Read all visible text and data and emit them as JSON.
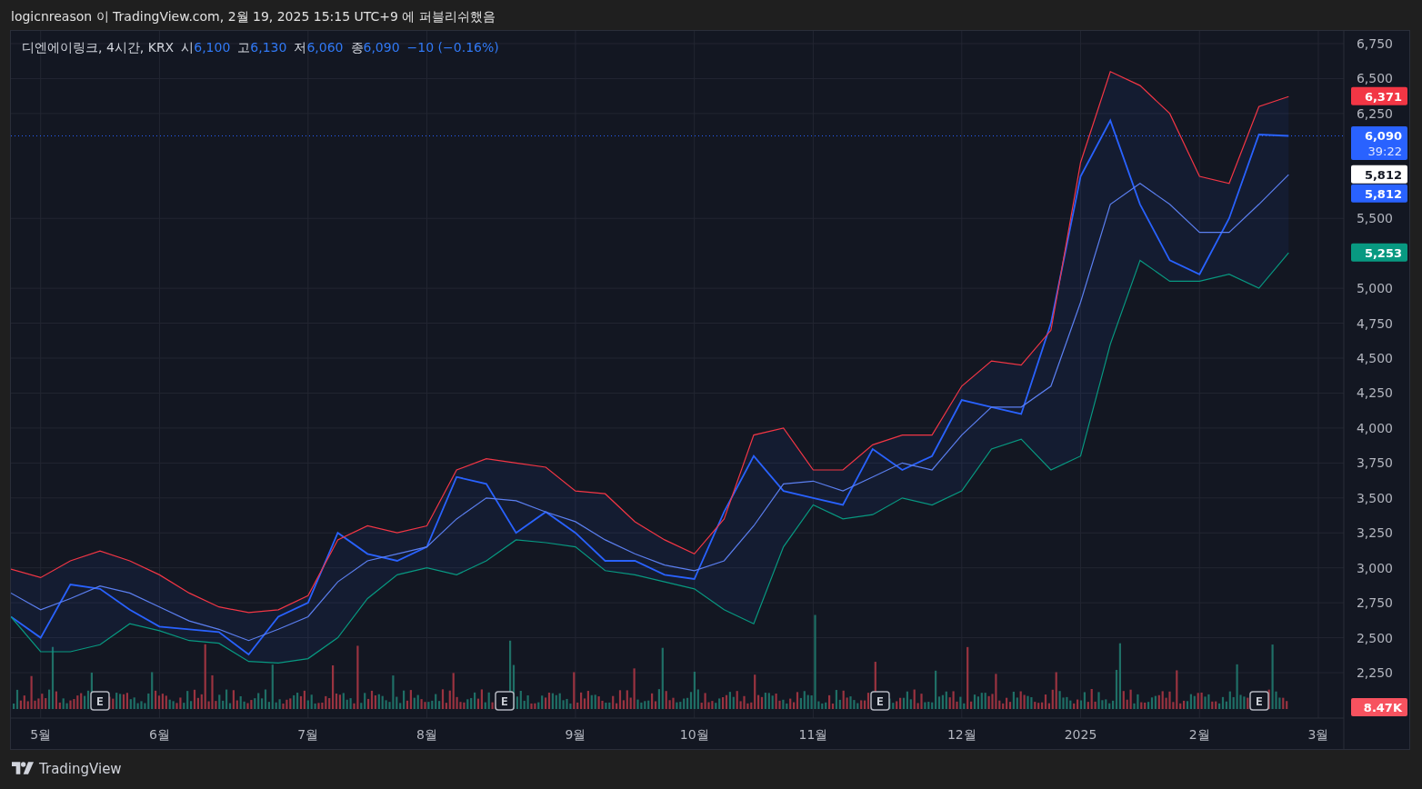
{
  "header": {
    "text": "logicnreason 이 TradingView.com, 2월 19, 2025 15:15 UTC+9 에 퍼블리쉬했음"
  },
  "legend": {
    "symbol": "디엔에이링크, 4시간, KRX",
    "values": [
      {
        "label": "시",
        "value": "6,100"
      },
      {
        "label": "고",
        "value": "6,130"
      },
      {
        "label": "저",
        "value": "6,060"
      },
      {
        "label": "종",
        "value": "6,090"
      }
    ],
    "change": "−10 (−0.16%)"
  },
  "chart": {
    "chart_data": {
      "type": "line",
      "grid": true,
      "categories": [
        null,
        "5월",
        null,
        null,
        null,
        "6월",
        null,
        null,
        null,
        null,
        "7월",
        null,
        null,
        null,
        "8월",
        null,
        null,
        null,
        null,
        "9월",
        null,
        null,
        null,
        "10월",
        null,
        null,
        null,
        "11월",
        null,
        null,
        null,
        null,
        "12월",
        null,
        null,
        null,
        "2025",
        null,
        null,
        null,
        "2월",
        null,
        null,
        null,
        "3월",
        null
      ],
      "series": [
        {
          "color": "#2962ff",
          "values": [
            2650,
            2500,
            2880,
            2850,
            2700,
            2580,
            2560,
            2540,
            2380,
            2650,
            2750,
            3250,
            3100,
            3050,
            3150,
            3650,
            3600,
            3250,
            3400,
            3250,
            3050,
            3050,
            2950,
            2920,
            3400,
            3800,
            3550,
            3500,
            3450,
            3850,
            3700,
            3800,
            4200,
            4150,
            4100,
            4750,
            5800,
            6200,
            5600,
            5200,
            5100,
            5500,
            6100,
            6090,
            null,
            null
          ]
        },
        {
          "color": "#f23645",
          "values": [
            2990,
            2930,
            3050,
            3120,
            3050,
            2950,
            2820,
            2720,
            2680,
            2700,
            2800,
            3200,
            3300,
            3250,
            3300,
            3700,
            3780,
            3750,
            3720,
            3550,
            3530,
            3330,
            3200,
            3100,
            3350,
            3950,
            4000,
            3700,
            3700,
            3880,
            3950,
            3950,
            4300,
            4480,
            4450,
            4700,
            5900,
            6550,
            6450,
            6250,
            5800,
            5750,
            6300,
            6371,
            null,
            null
          ]
        },
        {
          "color": "#5b7ff0",
          "values": [
            2820,
            2700,
            2780,
            2870,
            2820,
            2720,
            2620,
            2560,
            2480,
            2560,
            2650,
            2900,
            3050,
            3100,
            3150,
            3350,
            3500,
            3480,
            3400,
            3330,
            3200,
            3100,
            3020,
            2980,
            3050,
            3300,
            3600,
            3620,
            3550,
            3650,
            3750,
            3700,
            3950,
            4150,
            4150,
            4300,
            4900,
            5600,
            5750,
            5600,
            5400,
            5400,
            5600,
            5812,
            null,
            null
          ]
        },
        {
          "color": "#089981",
          "values": [
            2650,
            2400,
            2400,
            2450,
            2600,
            2550,
            2480,
            2460,
            2330,
            2320,
            2350,
            2500,
            2780,
            2950,
            3000,
            2950,
            3050,
            3200,
            3180,
            3150,
            2980,
            2950,
            2900,
            2850,
            2700,
            2600,
            3150,
            3450,
            3350,
            3380,
            3500,
            3450,
            3550,
            3850,
            3920,
            3700,
            3800,
            4600,
            5200,
            5050,
            5050,
            5100,
            5000,
            5253,
            null,
            null
          ]
        }
      ],
      "ylim": [
        1925,
        6841
      ],
      "yticks": [
        {
          "value": 2250,
          "label": "2,250"
        },
        {
          "value": 2500,
          "label": "2,500"
        },
        {
          "value": 2750,
          "label": "2,750"
        },
        {
          "value": 3000,
          "label": "3,000"
        },
        {
          "value": 3250,
          "label": "3,250"
        },
        {
          "value": 3500,
          "label": "3,500"
        },
        {
          "value": 3750,
          "label": "3,750"
        },
        {
          "value": 4000,
          "label": "4,000"
        },
        {
          "value": 4250,
          "label": "4,250"
        },
        {
          "value": 4500,
          "label": "4,500"
        },
        {
          "value": 4750,
          "label": "4,750"
        },
        {
          "value": 5000,
          "label": "5,000"
        },
        {
          "value": 5500,
          "label": "5,500"
        },
        {
          "value": 6250,
          "label": "6,250"
        },
        {
          "value": 6500,
          "label": "6,500"
        },
        {
          "value": 6750,
          "label": "6,750"
        }
      ],
      "annotations": [
        "E",
        "E",
        "E",
        "E"
      ]
    },
    "price_labels": [
      {
        "kind": "band_upper",
        "text": "6,371",
        "color": "#f23645"
      },
      {
        "kind": "last_price",
        "text": "6,090",
        "countdown": "39:22",
        "color": "#2962ff"
      },
      {
        "kind": "band_middle",
        "text": "5,812",
        "color": "#ffffff"
      },
      {
        "kind": "band_middle",
        "text": "5,812",
        "color": "#2962ff"
      },
      {
        "kind": "band_lower",
        "text": "5,253",
        "color": "#089981"
      },
      {
        "kind": "volume",
        "text": "8.47K",
        "color": "#f7525f"
      }
    ]
  },
  "footer": {
    "brand": "TradingView"
  }
}
